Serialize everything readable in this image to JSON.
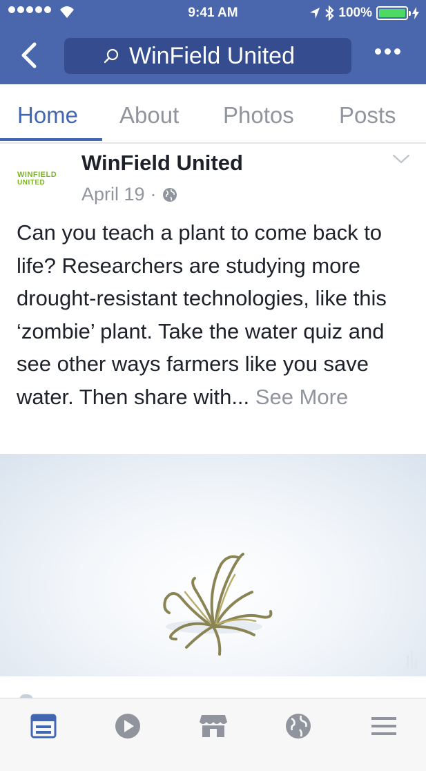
{
  "status_bar": {
    "time": "9:41 AM",
    "battery": "100%",
    "battery_level": 1.0
  },
  "header": {
    "search_text": "WinField United"
  },
  "tabs": [
    {
      "label": "Home",
      "active": true
    },
    {
      "label": "About"
    },
    {
      "label": "Photos"
    },
    {
      "label": "Posts"
    }
  ],
  "post": {
    "page_name": "WinField United",
    "date": "April 19",
    "separator": "·",
    "logo_text_line1": "WINFIELD",
    "logo_text_line2": "UNITED",
    "body": "Can you teach a plant to come back to life? Researchers are studying more drought-resistant technologies, like this ‘zombie’ plant. Take the water quiz and see other ways farmers like you save water. Then share with...",
    "see_more": "See More"
  },
  "bottom_nav": [
    "news-feed-icon",
    "video-icon",
    "marketplace-icon",
    "globe-icon",
    "menu-icon"
  ],
  "colors": {
    "brand_blue": "#4a67ad",
    "search_bg": "#354d8f",
    "active_blue": "#4267b2",
    "muted": "#90949c",
    "logo_green": "#7ab51d"
  }
}
